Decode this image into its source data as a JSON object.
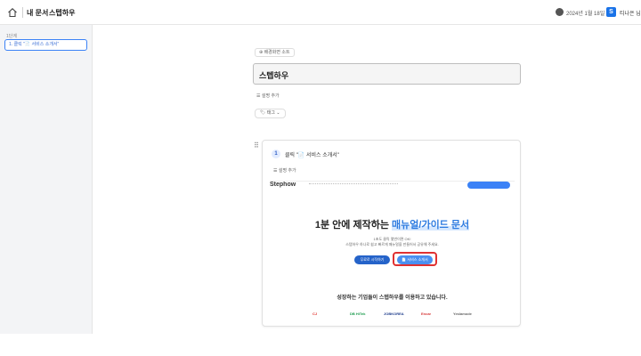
{
  "header": {
    "breadcrumb": [
      "내 문서",
      "스텝하우"
    ],
    "breadcrumb_sep": ">",
    "date": "2024년 1월 18일",
    "user_initial": "S",
    "user_name": "티나은 님"
  },
  "sidebar": {
    "section_title": "1단계",
    "items": [
      {
        "label": "1. 클릭 \"📄 서비스 소개서\""
      }
    ]
  },
  "editor": {
    "top_chip": "⊕ 배경화면 소트",
    "title": "스텝하우",
    "desc_add": "☰ 설명 추가",
    "tag_chip": "🏷 태그 ⌄",
    "drag_handle": "⠿"
  },
  "step": {
    "number": "1",
    "text": "클릭 \"📄 서비스 소개서\"",
    "desc_add": "☰ 설명 추가"
  },
  "screenshot": {
    "logo": "Stephow",
    "headline_prefix": "1분 안에 제작하는 ",
    "headline_highlight": "매뉴얼/가이드 문서",
    "sub1": "1초도 클릭 몇번이면 OK!",
    "sub2": "스텝하우 하나로 쉽고 빠르게 매뉴얼을 만들어서 공유해 주세요.",
    "btn_primary": "무료로 시작하기",
    "btn_secondary": "📄 서비스 소개서",
    "tagline": "성장하는 기업들이 스텝하우를 이용하고 있습니다.",
    "logos": [
      {
        "text": "CJ",
        "color": "#e0312b"
      },
      {
        "text": "DB HiTek",
        "color": "#1a9b4c"
      },
      {
        "text": "JOBKOREA",
        "color": "#1f3d8c"
      },
      {
        "text": "Encar",
        "color": "#d73a3a"
      },
      {
        "text": "Yeslamode",
        "color": "#666666"
      }
    ]
  },
  "colors": {
    "accent": "#3b82f6",
    "highlight_ring": "#e03131"
  }
}
